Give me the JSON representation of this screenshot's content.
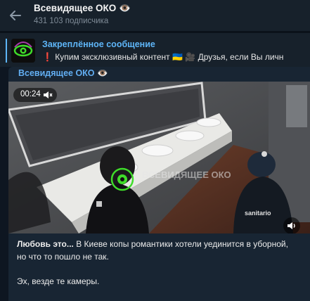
{
  "header": {
    "back_icon": "arrow-left-icon",
    "channel_name": "Всевидящее ОКО",
    "channel_emoji": "👁️",
    "subscribers": "431 103 подписчика"
  },
  "pinned": {
    "title": "Закреплённое сообщение",
    "exclamation": "❗",
    "text": "Купим эксклюзивный контент 🇺🇦 🎥 Друзья, если Вы личн"
  },
  "post": {
    "author": "Всевидящее ОКО",
    "author_emoji": "👁️",
    "video": {
      "duration": "00:24",
      "muted_icon": "speaker-muted-icon",
      "watermark": "ВСЕВИДЯЩЕЕ ОКО",
      "sanitario": "sanitario",
      "sound_icon": "speaker-icon"
    },
    "caption_bold": "Любовь это...",
    "caption_rest": " В Киеве копы романтики хотели уединится в уборной, но что то пошло не так.",
    "caption_second": "Эх, везде те камеры."
  },
  "colors": {
    "bg": "#0e1621",
    "header_bg": "#17212b",
    "accent": "#5eb5f7",
    "author": "#62aef2",
    "bubble": "#182533"
  }
}
